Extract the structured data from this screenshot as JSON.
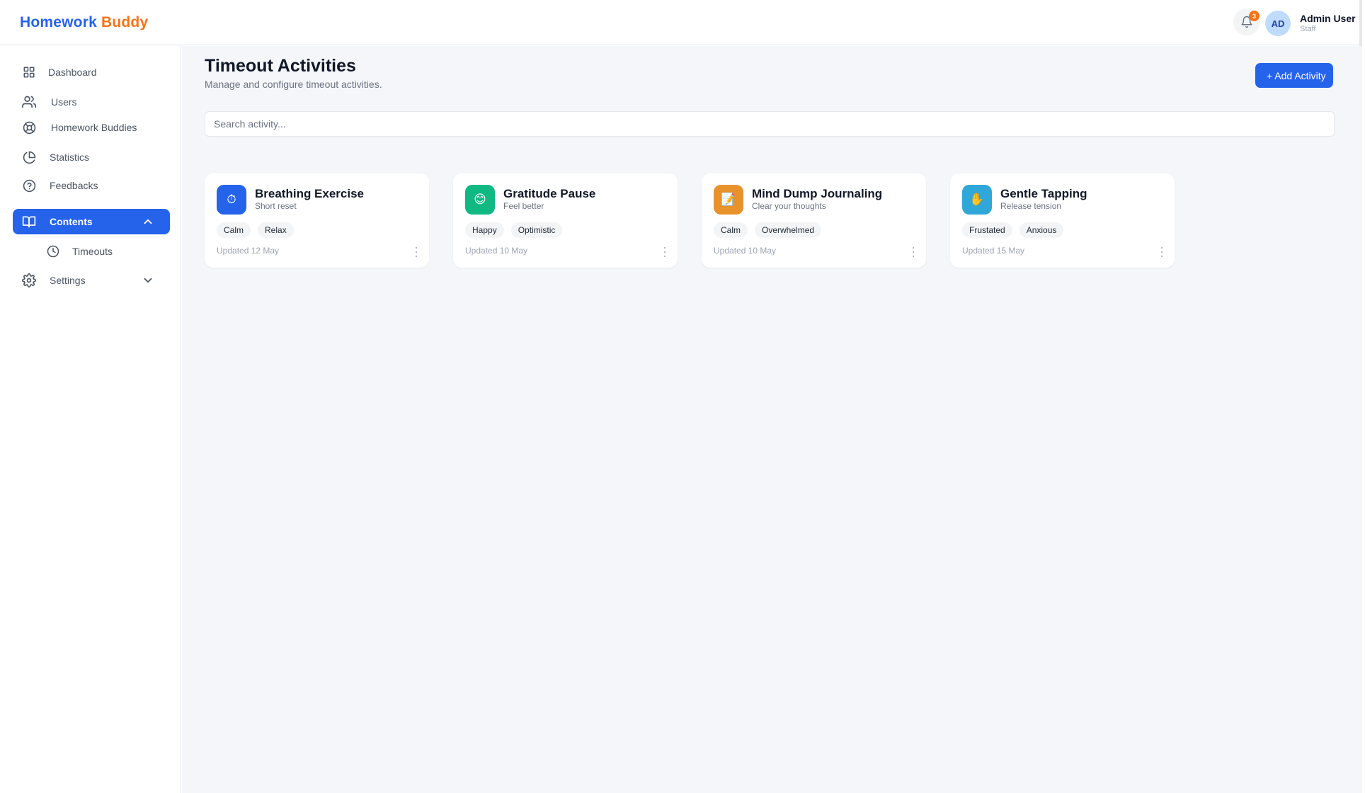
{
  "header": {
    "brand_part1": "Homework",
    "brand_part2": "Buddy",
    "notification_count": "3",
    "avatar_initials": "AD",
    "user_name": "Admin User",
    "user_role": "Staff"
  },
  "sidebar": {
    "items": [
      {
        "label": "Dashboard",
        "icon": "grid-icon"
      },
      {
        "label": "Users",
        "icon": "users-icon"
      },
      {
        "label": "Homework Buddies",
        "icon": "lifebuoy-icon"
      },
      {
        "label": "Statistics",
        "icon": "pie-chart-icon"
      },
      {
        "label": "Feedbacks",
        "icon": "help-circle-icon"
      },
      {
        "label": "Contents",
        "icon": "book-open-icon",
        "active": true,
        "expanded": true
      },
      {
        "label": "Timeouts",
        "icon": "clock-icon",
        "sub_item": true
      },
      {
        "label": "Settings",
        "icon": "gear-icon",
        "expanded": false
      }
    ]
  },
  "main": {
    "title": "Timeout Activities",
    "subtitle": "Manage and configure timeout activities.",
    "add_button_label": "+ Add Activity",
    "search": {
      "placeholder": "Search activity...",
      "value": ""
    },
    "cards": [
      {
        "title": "Breathing Exercise",
        "subtitle": "Short reset",
        "tags": [
          "Calm",
          "Relax"
        ],
        "updated": "Updated 12 May",
        "icon": "stopwatch-icon",
        "icon_glyph": "⏱",
        "color": "#2563eb"
      },
      {
        "title": "Gratitude Pause",
        "subtitle": "Feel better",
        "tags": [
          "Happy",
          "Optimistic"
        ],
        "updated": "Updated 10 May",
        "icon": "smile-icon",
        "icon_glyph": "😊",
        "color": "#10b981"
      },
      {
        "title": "Mind Dump Journaling",
        "subtitle": "Clear your thoughts",
        "tags": [
          "Calm",
          "Overwhelmed"
        ],
        "updated": "Updated 10 May",
        "icon": "memo-icon",
        "icon_glyph": "📝",
        "color": "#e8922b"
      },
      {
        "title": "Gentle Tapping",
        "subtitle": "Release tension",
        "tags": [
          "Frustated",
          "Anxious"
        ],
        "updated": "Updated 15 May",
        "icon": "hand-icon",
        "icon_glyph": "✋",
        "color": "#2fa7d9"
      }
    ]
  },
  "colors": {
    "primary": "#2563eb",
    "brand_accent": "#f97316",
    "background": "#f4f6fa"
  }
}
